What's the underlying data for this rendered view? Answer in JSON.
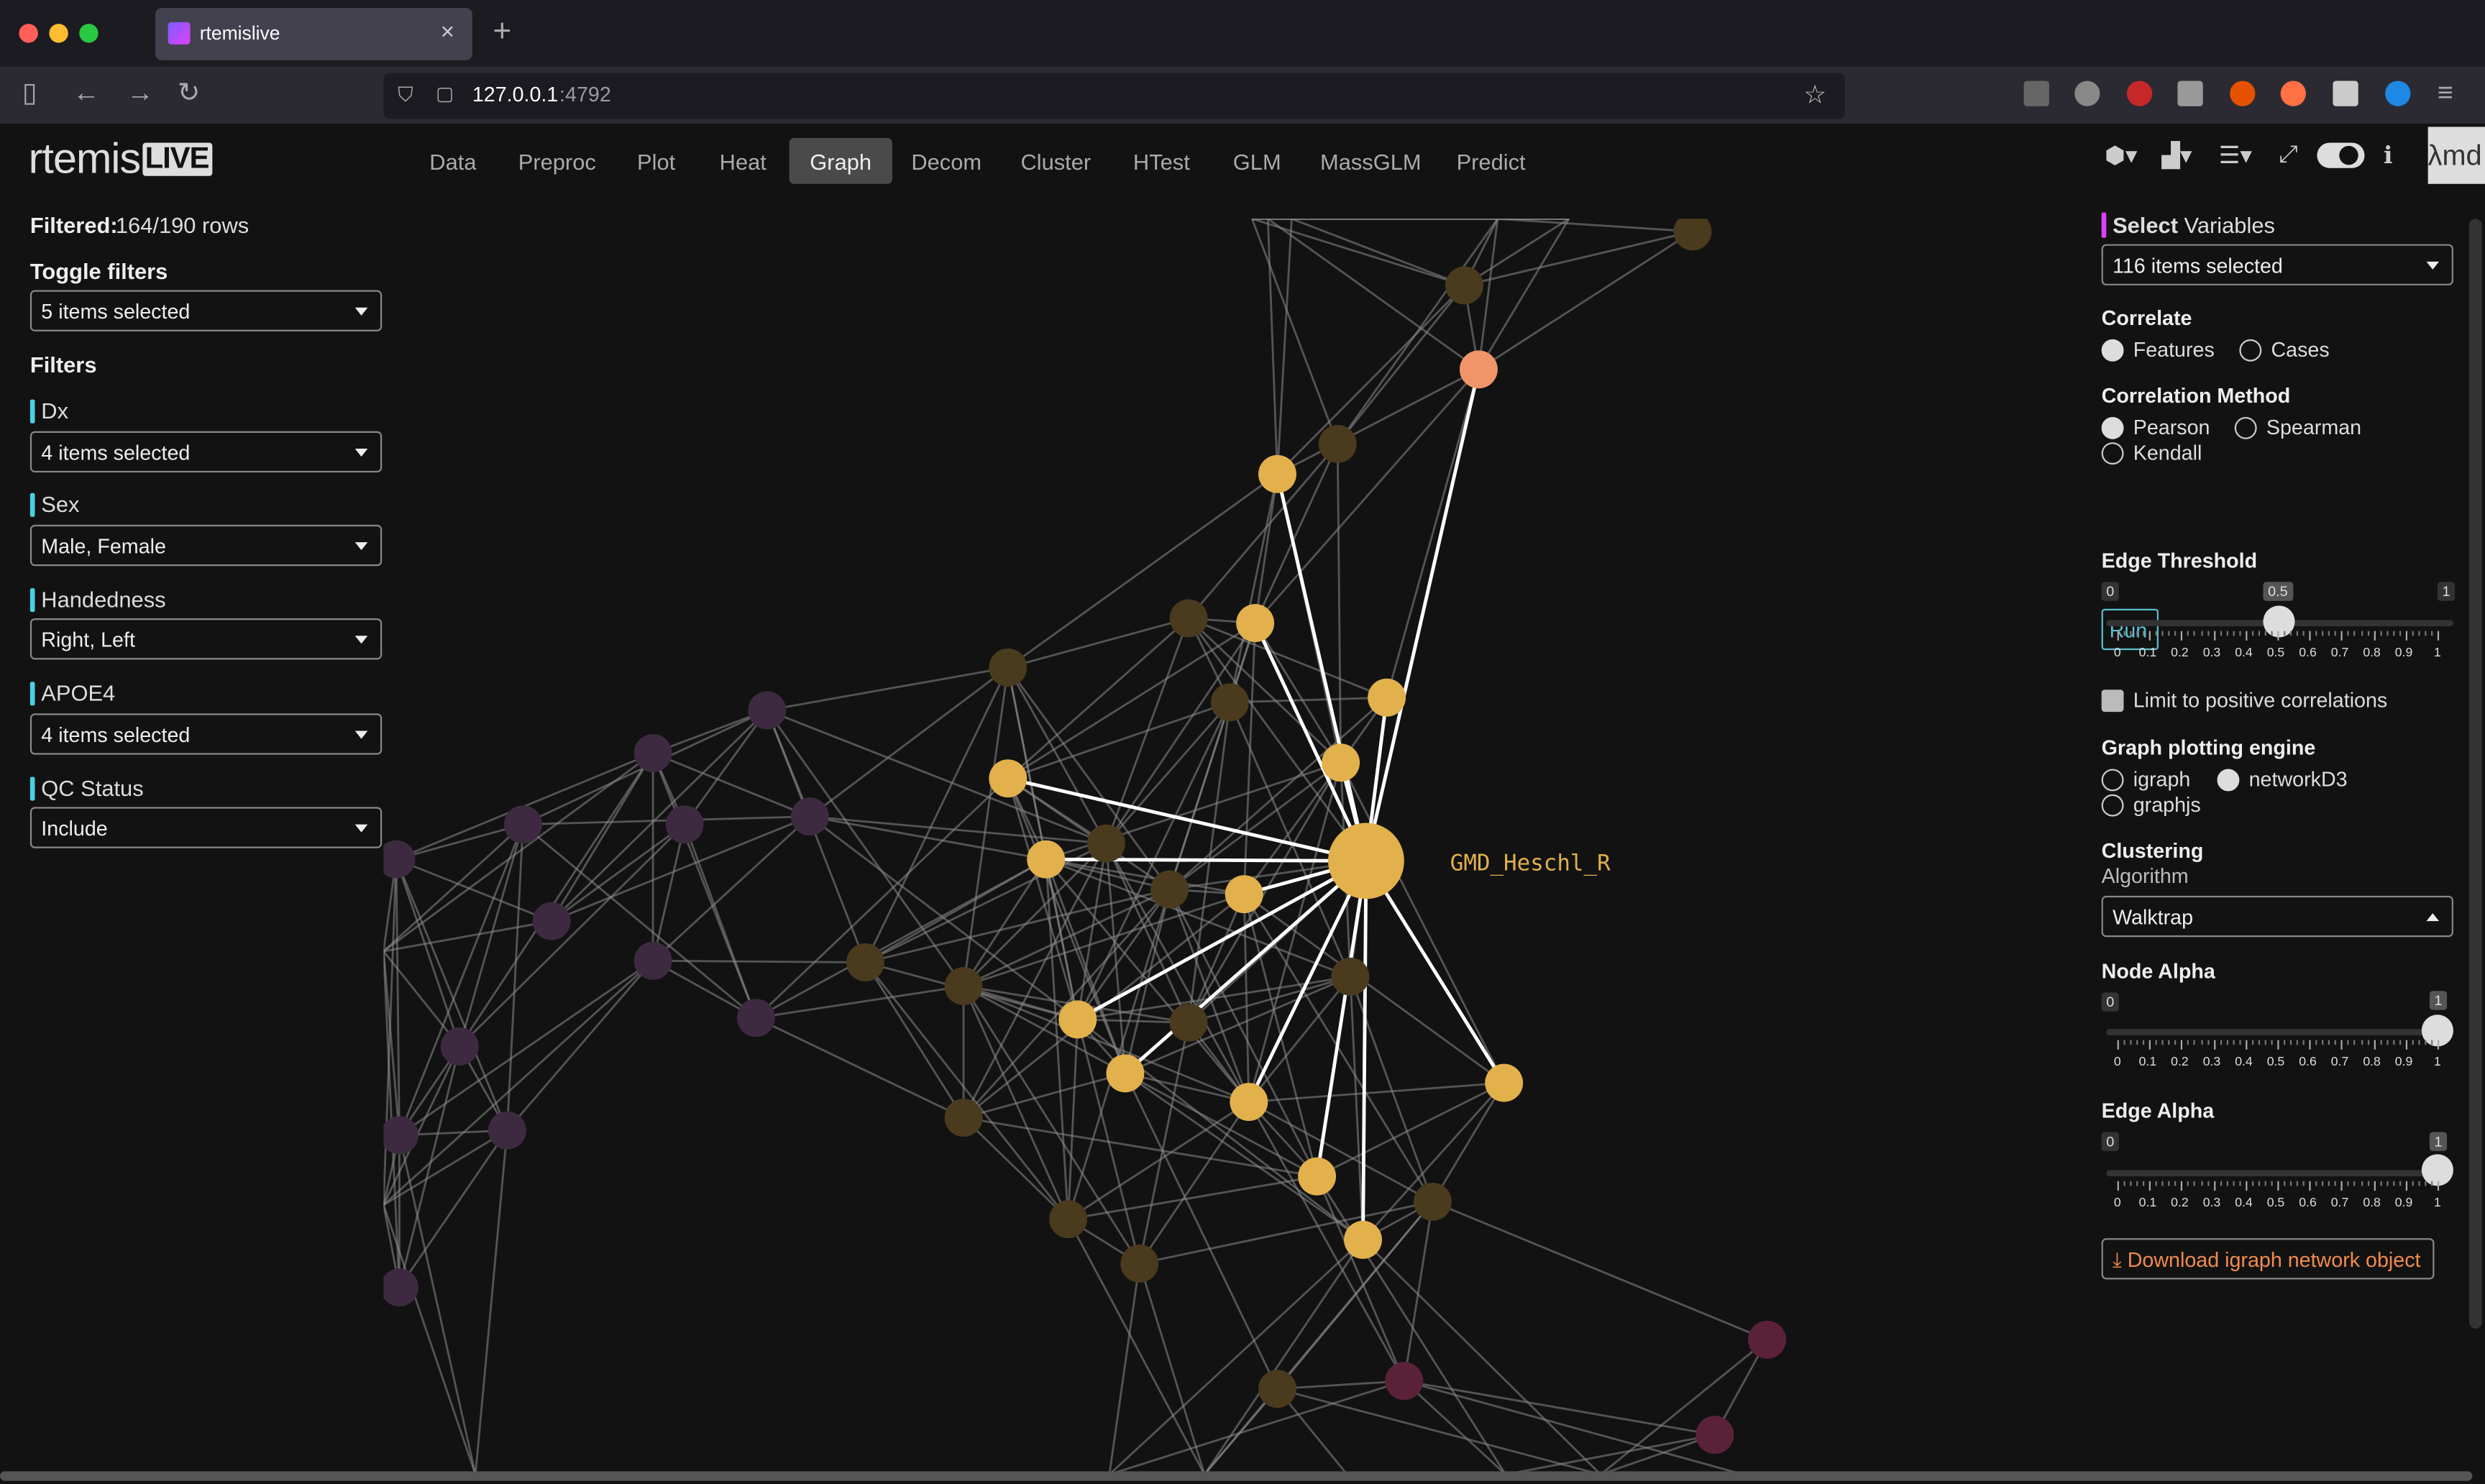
{
  "browser": {
    "tab_title": "rtemislive",
    "tab_close": "×",
    "new_tab": "+",
    "url_host": "127.0.0.1",
    "url_port": ":4792"
  },
  "app": {
    "logo_main": "rtemis",
    "logo_live": "LIVE",
    "nav": [
      "Data",
      "Preproc",
      "Plot",
      "Heat",
      "Graph",
      "Decom",
      "Cluster",
      "HTest",
      "GLM",
      "MassGLM",
      "Predict"
    ],
    "active_nav": "Graph",
    "lambda_text": "λmd"
  },
  "sidebar": {
    "filtered_label": "Filtered:",
    "filtered_value": "164/190 rows",
    "toggle_filters_label": "Toggle filters",
    "toggle_filters_value": "5 items selected",
    "filters_label": "Filters",
    "filters": [
      {
        "name": "Dx",
        "value": "4 items selected"
      },
      {
        "name": "Sex",
        "value": "Male, Female"
      },
      {
        "name": "Handedness",
        "value": "Right, Left"
      },
      {
        "name": "APOE4",
        "value": "4 items selected"
      },
      {
        "name": "QC Status",
        "value": "Include"
      }
    ]
  },
  "panel": {
    "select_label_bold": "Select",
    "select_label_rest": " Variables",
    "select_value": "116 items selected",
    "correlate_label": "Correlate",
    "correlate_options": [
      "Features",
      "Cases"
    ],
    "correlate_selected": "Features",
    "method_label": "Correlation Method",
    "method_options": [
      "Pearson",
      "Spearman",
      "Kendall"
    ],
    "method_selected": "Pearson",
    "run_label": "Run",
    "edge_threshold_label": "Edge Threshold",
    "edge_threshold_min": "0",
    "edge_threshold_max": "1",
    "edge_threshold_value": 0.5,
    "edge_threshold_value_label": "0.5",
    "limit_positive_label": "Limit to positive correlations",
    "limit_positive_checked": false,
    "engine_label": "Graph plotting engine",
    "engine_options": [
      "igraph",
      "networkD3",
      "graphjs"
    ],
    "engine_selected": "networkD3",
    "clustering_label": "Clustering",
    "algorithm_label": "Algorithm",
    "algorithm_value": "Walktrap",
    "node_alpha_label": "Node Alpha",
    "node_alpha_min": "0",
    "node_alpha_value": 1,
    "node_alpha_value_label": "1",
    "edge_alpha_label": "Edge Alpha",
    "edge_alpha_min": "0",
    "edge_alpha_value": 1,
    "edge_alpha_value_label": "1",
    "tick_labels": [
      "0",
      "0.1",
      "0.2",
      "0.3",
      "0.4",
      "0.5",
      "0.6",
      "0.7",
      "0.8",
      "0.9",
      "1"
    ],
    "download_label": "Download igraph network object"
  },
  "graph": {
    "focus_node_label": "GMD_Heschl_R",
    "colors": {
      "highlight": "#e2b14c",
      "salmon": "#f0956a",
      "dim_brown": "#4a3a1e",
      "dim_purple": "#3d2a40",
      "edge": "#8a8a8a"
    }
  }
}
